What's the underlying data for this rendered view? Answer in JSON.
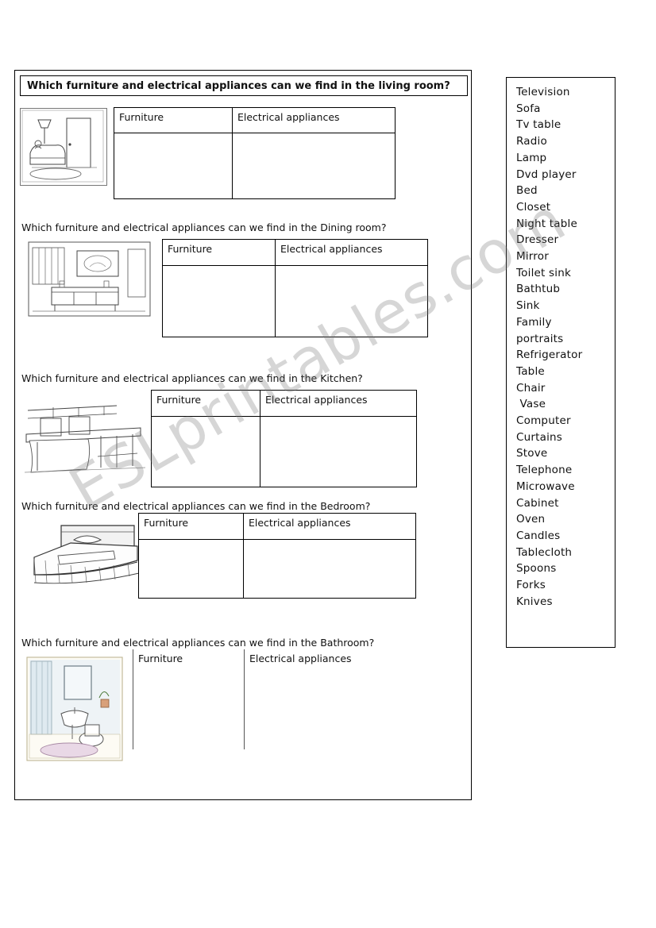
{
  "document": {
    "title": "Furniture and electrical appliances worksheet",
    "watermark": "ESLprintables.com"
  },
  "sections": [
    {
      "id": "living-room",
      "question": "Which furniture and electrical appliances can we find in the living room?",
      "boxed": true,
      "columns": [
        "Furniture",
        "Electrical appliances"
      ],
      "illustration": "living-room-illustration"
    },
    {
      "id": "dining-room",
      "question": "Which furniture and electrical appliances can we find in the Dining room?",
      "boxed": false,
      "columns": [
        "Furniture",
        "Electrical appliances"
      ],
      "illustration": "dining-room-illustration"
    },
    {
      "id": "kitchen",
      "question": "Which furniture and electrical appliances can we find in the Kitchen?",
      "boxed": false,
      "columns": [
        "Furniture",
        "Electrical appliances"
      ],
      "illustration": "kitchen-illustration"
    },
    {
      "id": "bedroom",
      "question": "Which furniture and electrical appliances can we find in the Bedroom?",
      "boxed": false,
      "columns": [
        "Furniture",
        "Electrical appliances"
      ],
      "illustration": "bedroom-illustration"
    },
    {
      "id": "bathroom",
      "question": "Which furniture and electrical appliances can we find in the Bathroom?",
      "boxed": false,
      "columns": [
        "Furniture",
        "Electrical appliances"
      ],
      "illustration": "bathroom-illustration"
    }
  ],
  "word_bank": {
    "items": [
      "Television",
      "Sofa",
      "Tv table",
      "Radio",
      "Lamp",
      "Dvd player",
      "Bed",
      "Closet",
      "Night table",
      "Dresser",
      "Mirror",
      "Toilet sink",
      "Bathtub",
      "Sink",
      "Family",
      "portraits",
      "Refrigerator",
      "Table",
      "Chair",
      " Vase",
      "Computer",
      "Curtains",
      "Stove",
      "Telephone",
      "Microwave",
      "Cabinet",
      "Oven",
      "Candles",
      "Tablecloth",
      "Spoons",
      "Forks",
      "Knives"
    ]
  }
}
